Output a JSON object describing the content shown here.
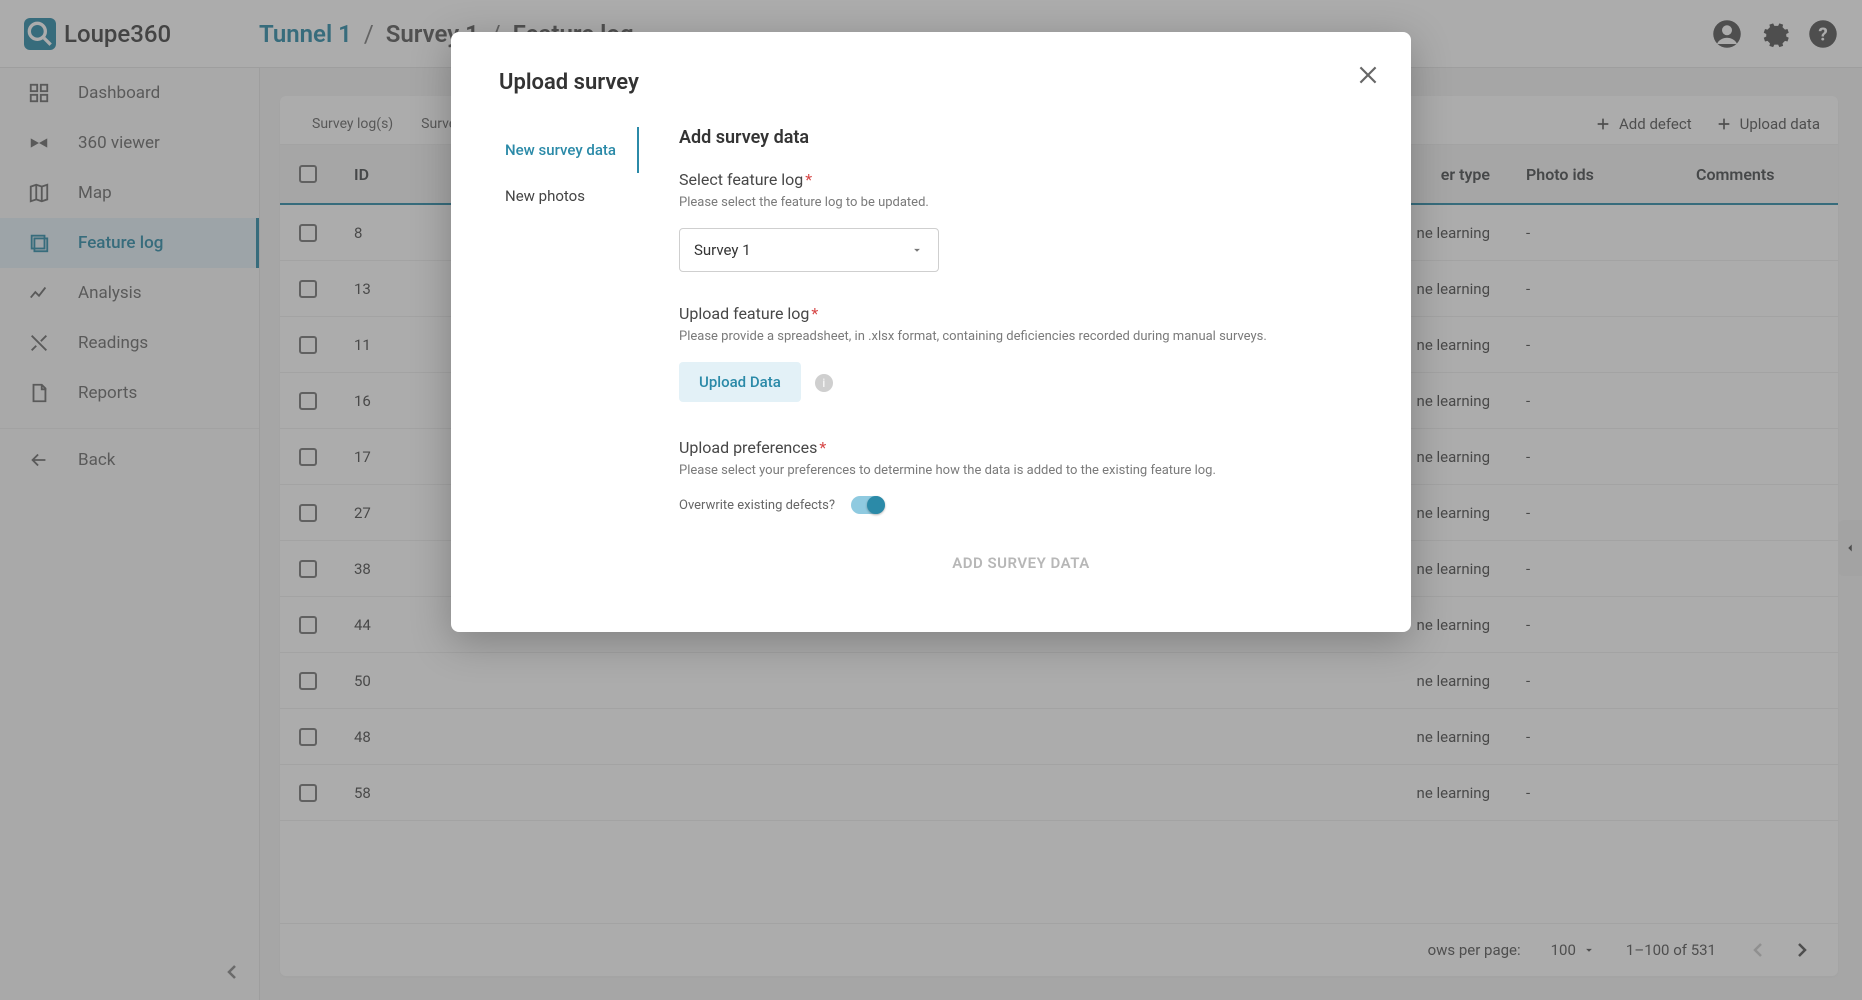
{
  "app_name": "Loupe360",
  "breadcrumb": {
    "tunnel": "Tunnel 1",
    "survey": "Survey 1",
    "page": "Feature log"
  },
  "sidebar": {
    "items": [
      {
        "label": "Dashboard"
      },
      {
        "label": "360 viewer"
      },
      {
        "label": "Map"
      },
      {
        "label": "Feature log"
      },
      {
        "label": "Analysis"
      },
      {
        "label": "Readings"
      },
      {
        "label": "Reports"
      }
    ],
    "back_label": "Back"
  },
  "card": {
    "tabs": [
      "Survey log(s)",
      "Survey"
    ],
    "actions": {
      "add_defect": "Add defect",
      "upload_data": "Upload data"
    },
    "columns": {
      "id": "ID",
      "reviewer_type": "er type",
      "photo_ids": "Photo ids",
      "comments": "Comments"
    },
    "rows": [
      {
        "id": "8",
        "reviewer_type": "ne learning",
        "photo_ids": "-"
      },
      {
        "id": "13",
        "reviewer_type": "ne learning",
        "photo_ids": "-"
      },
      {
        "id": "11",
        "reviewer_type": "ne learning",
        "photo_ids": "-"
      },
      {
        "id": "16",
        "reviewer_type": "ne learning",
        "photo_ids": "-"
      },
      {
        "id": "17",
        "reviewer_type": "ne learning",
        "photo_ids": "-"
      },
      {
        "id": "27",
        "reviewer_type": "ne learning",
        "photo_ids": "-"
      },
      {
        "id": "38",
        "reviewer_type": "ne learning",
        "photo_ids": "-"
      },
      {
        "id": "44",
        "reviewer_type": "ne learning",
        "photo_ids": "-"
      },
      {
        "id": "50",
        "reviewer_type": "ne learning",
        "photo_ids": "-"
      },
      {
        "id": "48",
        "reviewer_type": "ne learning",
        "photo_ids": "-"
      },
      {
        "id": "58",
        "reviewer_type": "ne learning",
        "photo_ids": "-"
      }
    ],
    "footer": {
      "rows_per_page_label": "ows per page:",
      "rows_per_page_value": "100",
      "range": "1–100 of 531"
    }
  },
  "modal": {
    "title": "Upload survey",
    "tabs": [
      "New survey data",
      "New photos"
    ],
    "heading": "Add survey data",
    "select_feature": {
      "label": "Select feature log",
      "help": "Please select the feature log to be updated.",
      "value": "Survey 1"
    },
    "upload_feature": {
      "label": "Upload feature log",
      "help": "Please provide a spreadsheet, in .xlsx format, containing deficiencies recorded during manual surveys.",
      "button": "Upload Data"
    },
    "upload_prefs": {
      "label": "Upload preferences",
      "help": "Please select your preferences to determine how the data is added to the existing feature log.",
      "toggle_label": "Overwrite existing defects?"
    },
    "submit": "ADD SURVEY DATA"
  }
}
